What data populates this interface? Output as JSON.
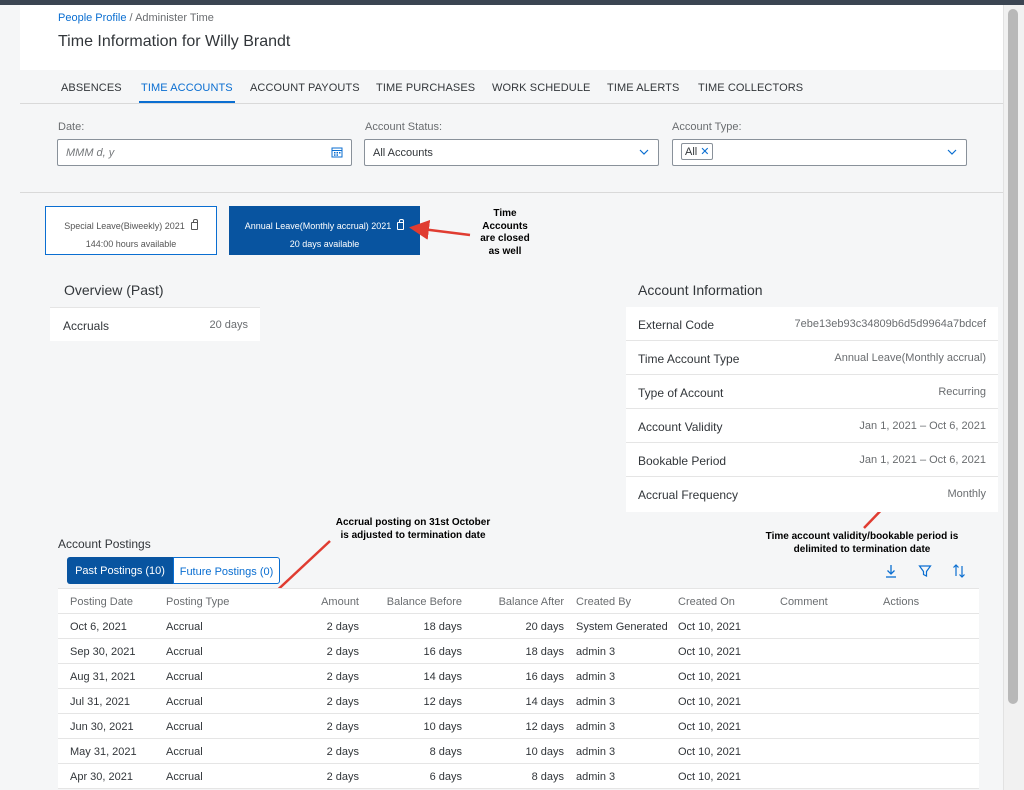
{
  "breadcrumb": {
    "link": "People Profile",
    "separator": " / ",
    "current": "Administer Time"
  },
  "page_title": "Time Information for Willy Brandt",
  "tabs": [
    {
      "label": "ABSENCES",
      "active": false
    },
    {
      "label": "TIME ACCOUNTS",
      "active": true
    },
    {
      "label": "ACCOUNT PAYOUTS",
      "active": false
    },
    {
      "label": "TIME PURCHASES",
      "active": false
    },
    {
      "label": "WORK SCHEDULE",
      "active": false
    },
    {
      "label": "TIME ALERTS",
      "active": false
    },
    {
      "label": "TIME COLLECTORS",
      "active": false
    }
  ],
  "filters": {
    "date": {
      "label": "Date:",
      "placeholder": "MMM d, y",
      "icon": "calendar-icon"
    },
    "status": {
      "label": "Account Status:",
      "value": "All Accounts",
      "icon": "chevron-down-icon"
    },
    "type": {
      "label": "Account Type:",
      "token": "All",
      "icon": "chevron-down-icon"
    }
  },
  "cards": [
    {
      "title": "Special Leave(Biweekly) 2021",
      "subtitle": "144:00 hours available",
      "selected": false,
      "icon": "lock-icon"
    },
    {
      "title": "Annual Leave(Monthly accrual) 2021",
      "subtitle": "20 days available",
      "selected": true,
      "icon": "lock-icon"
    }
  ],
  "annotations": {
    "closed": [
      "Time",
      "Accounts",
      "are closed",
      "as well"
    ],
    "accrual": [
      "Accrual posting on 31st October",
      "is adjusted to termination date"
    ],
    "validity": [
      "Time account validity/bookable period is",
      "delimited to termination date"
    ]
  },
  "overview": {
    "title": "Overview (Past)",
    "rows": [
      {
        "label": "Accruals",
        "value": "20 days"
      }
    ]
  },
  "account_info": {
    "title": "Account Information",
    "rows": [
      {
        "label": "External Code",
        "value": "7ebe13eb93c34809b6d5d9964a7bdcef"
      },
      {
        "label": "Time Account Type",
        "value": "Annual Leave(Monthly accrual)"
      },
      {
        "label": "Type of Account",
        "value": "Recurring"
      },
      {
        "label": "Account Validity",
        "value": "Jan 1, 2021 – Oct 6, 2021"
      },
      {
        "label": "Bookable Period",
        "value": "Jan 1, 2021 – Oct 6, 2021"
      },
      {
        "label": "Accrual Frequency",
        "value": "Monthly"
      }
    ]
  },
  "postings": {
    "title": "Account Postings",
    "segments": {
      "past": "Past Postings (10)",
      "future": "Future Postings (0)"
    },
    "toolbar_icons": [
      "download-icon",
      "filter-icon",
      "sort-icon"
    ],
    "columns": [
      "Posting Date",
      "Posting Type",
      "Amount",
      "Balance Before",
      "Balance After",
      "Created By",
      "Created On",
      "Comment",
      "Actions"
    ],
    "rows": [
      [
        "Oct 6, 2021",
        "Accrual",
        "2 days",
        "18 days",
        "20 days",
        "System Generated",
        "Oct 10, 2021"
      ],
      [
        "Sep 30, 2021",
        "Accrual",
        "2 days",
        "16 days",
        "18 days",
        "admin 3",
        "Oct 10, 2021"
      ],
      [
        "Aug 31, 2021",
        "Accrual",
        "2 days",
        "14 days",
        "16 days",
        "admin 3",
        "Oct 10, 2021"
      ],
      [
        "Jul 31, 2021",
        "Accrual",
        "2 days",
        "12 days",
        "14 days",
        "admin 3",
        "Oct 10, 2021"
      ],
      [
        "Jun 30, 2021",
        "Accrual",
        "2 days",
        "10 days",
        "12 days",
        "admin 3",
        "Oct 10, 2021"
      ],
      [
        "May 31, 2021",
        "Accrual",
        "2 days",
        "8 days",
        "10 days",
        "admin 3",
        "Oct 10, 2021"
      ],
      [
        "Apr 30, 2021",
        "Accrual",
        "2 days",
        "6 days",
        "8 days",
        "admin 3",
        "Oct 10, 2021"
      ]
    ]
  },
  "colors": {
    "accent": "#0a6ed1",
    "selected": "#0854a0",
    "annotation_arrow": "#e03c31"
  }
}
